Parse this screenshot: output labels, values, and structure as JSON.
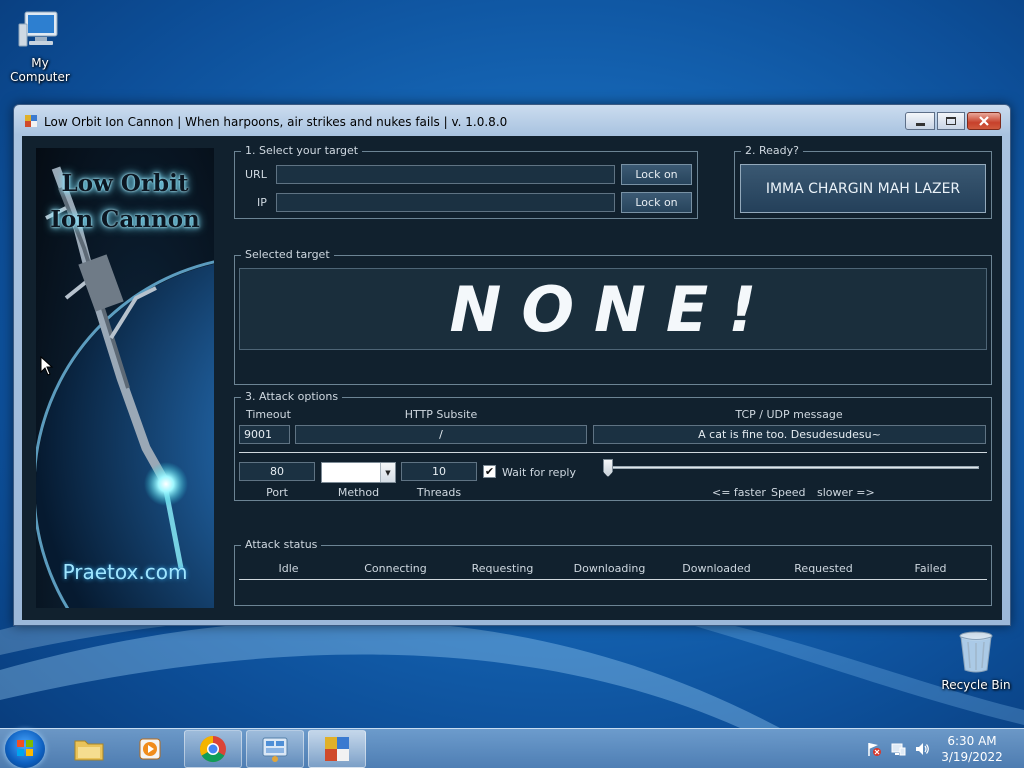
{
  "desktop": {
    "icons": {
      "my_computer": "My Computer",
      "recycle_bin": "Recycle Bin"
    }
  },
  "window": {
    "title": "Low Orbit Ion Cannon | When harpoons, air strikes and nukes fails | v. 1.0.8.0",
    "logo": {
      "line1": "Low Orbit",
      "line2": "Ion Cannon",
      "website": "Praetox.com"
    },
    "select_target": {
      "group_title": "1. Select your target",
      "url_label": "URL",
      "url_value": "",
      "ip_label": "IP",
      "ip_value": "",
      "lock_on_url": "Lock on",
      "lock_on_ip": "Lock on"
    },
    "ready": {
      "group_title": "2. Ready?",
      "fire_button": "IMMA CHARGIN MAH LAZER"
    },
    "selected_target": {
      "group_title": "Selected target",
      "value": "NONE!"
    },
    "attack_options": {
      "group_title": "3. Attack options",
      "timeout_label": "Timeout",
      "timeout_value": "9001",
      "http_subsite_label": "HTTP Subsite",
      "http_subsite_value": "/",
      "tcp_udp_label": "TCP / UDP message",
      "tcp_udp_value": "A cat is fine too. Desudesudesu~",
      "port_label": "Port",
      "port_value": "80",
      "method_label": "Method",
      "method_value": "",
      "threads_label": "Threads",
      "threads_value": "10",
      "wait_for_reply_label": "Wait for reply",
      "wait_for_reply_checked": true,
      "speed_faster": "<= faster",
      "speed_label": "Speed",
      "speed_slower": "slower =>",
      "speed_level": 0
    },
    "attack_status": {
      "group_title": "Attack status",
      "columns": [
        "Idle",
        "Connecting",
        "Requesting",
        "Downloading",
        "Downloaded",
        "Requested",
        "Failed"
      ]
    }
  },
  "taskbar": {
    "clock_time": "6:30 AM",
    "clock_date": "3/19/2022"
  },
  "colors": {
    "client_bg": "#11212e",
    "glow": "#7ee3ff",
    "accent": "#1668b8"
  }
}
